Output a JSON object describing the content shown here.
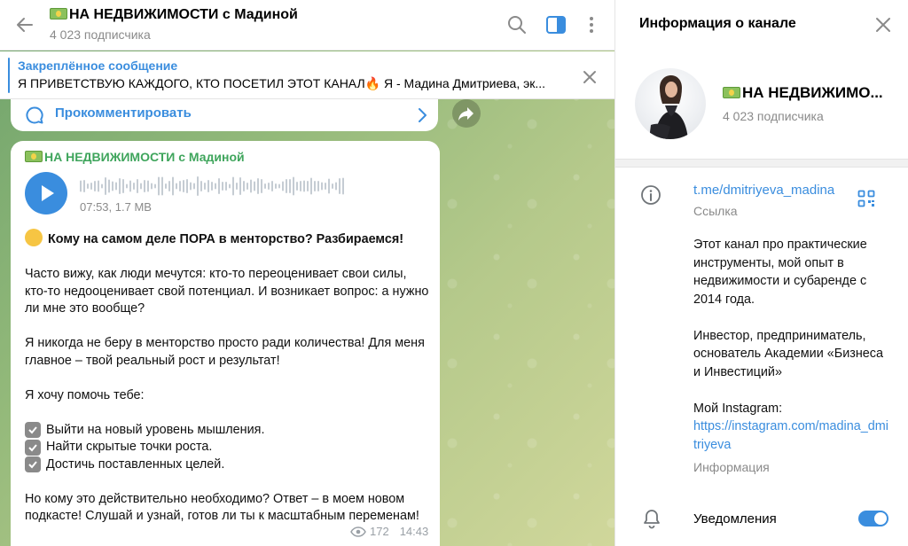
{
  "colors": {
    "accent": "#3a8dde",
    "author": "#3fa55c",
    "muted": "#8a8a8a"
  },
  "chat": {
    "title": "НА НЕДВИЖИМОСТИ с Мадиной",
    "subscribers": "4 023 подписчика",
    "icons": [
      "back-arrow-icon",
      "search-icon",
      "sidebar-toggle-icon",
      "more-vertical-icon"
    ]
  },
  "pinned": {
    "title": "Закреплённое сообщение",
    "text": "Я ПРИВЕТСТВУЮ КАЖДОГО, КТО ПОСЕТИЛ ЭТОТ КАНАЛ🔥 Я - Мадина Дмитриева, эк..."
  },
  "comment": {
    "label": "Прокомментировать"
  },
  "message": {
    "author": "НА НЕДВИЖИМОСТИ с Мадиной",
    "voice_meta": "07:53, 1.7 MB",
    "heading": "Кому на самом деле ПОРА в менторство? Разбираемся!",
    "p1": "Часто вижу, как люди мечутся: кто-то переоценивает свои силы, кто-то недооценивает свой потенциал. И возникает вопрос: а нужно ли мне это вообще?",
    "p2": "Я никогда не беру в менторство просто ради количества! Для меня главное – твой реальный рост и результат!",
    "p3": "Я хочу помочь тебе:",
    "checklist": [
      "Выйти на новый уровень мышления.",
      "Найти скрытые точки роста.",
      "Достичь поставленных целей."
    ],
    "p4": "Но кому это действительно необходимо? Ответ – в моем новом подкасте! Слушай и узнай, готов ли ты к масштабным переменам!",
    "views": "172",
    "time": "14:43"
  },
  "panel": {
    "title": "Информация о канале",
    "channel_name": "НА НЕДВИЖИМО...",
    "subscribers": "4 023 подписчика",
    "link": "t.me/dmitriyeva_madina",
    "link_label": "Ссылка",
    "desc1": "Этот канал про практические инструменты, мой опыт в недвижимости и субаренде с 2014 года.",
    "desc2": "Инвестор, предприниматель, основатель Академии «Бизнеса и Инвестиций»",
    "desc3": "Мой Instagram:",
    "instagram": "https://instagram.com/madina_dmitriyeva",
    "desc_label": "Информация",
    "notifications": "Уведомления",
    "notifications_on": true
  }
}
